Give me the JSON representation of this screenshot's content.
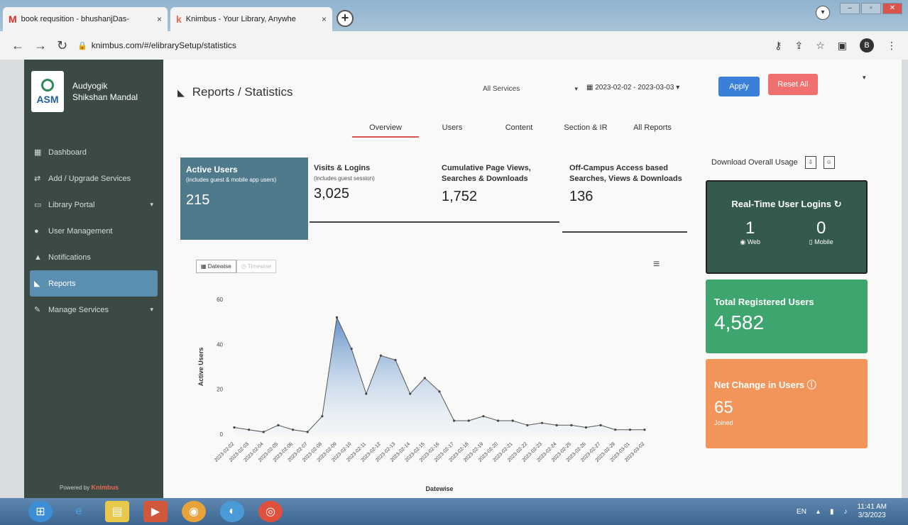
{
  "browser": {
    "tabs": [
      {
        "favicon": "M",
        "title": "book requsition - bhushanjDas-",
        "close": "×"
      },
      {
        "favicon": "k",
        "title": "Knimbus - Your Library, Anywhe",
        "close": "×"
      }
    ],
    "new_tab": "+",
    "url": "knimbus.com/#/elibrarySetup/statistics",
    "profile_initial": "B"
  },
  "sidebar": {
    "brand_logo_text": "ASM",
    "brand_name_line1": "Audyogik",
    "brand_name_line2": "Shikshan Mandal",
    "items": [
      {
        "icon": "▦",
        "label": "Dashboard",
        "arrow": ""
      },
      {
        "icon": "⇄",
        "label": "Add / Upgrade Services",
        "arrow": ""
      },
      {
        "icon": "▭",
        "label": "Library Portal",
        "arrow": "▾"
      },
      {
        "icon": "●",
        "label": "User Management",
        "arrow": ""
      },
      {
        "icon": "▲",
        "label": "Notifications",
        "arrow": ""
      },
      {
        "icon": "◣",
        "label": "Reports",
        "arrow": ""
      },
      {
        "icon": "✎",
        "label": "Manage Services",
        "arrow": "▾"
      }
    ],
    "powered_by": "Powered by",
    "powered_brand": "Knimbus"
  },
  "header": {
    "title": "Reports / Statistics",
    "service_select": "All Services",
    "date_range": "2023-02-02 - 2023-03-03",
    "apply_label": "Apply",
    "reset_label": "Reset All"
  },
  "tabs": [
    "Overview",
    "Users",
    "Content",
    "Section & IR",
    "All Reports"
  ],
  "stats": {
    "active_users": {
      "title": "Active Users",
      "subtitle": "(includes guest & mobile app users)",
      "value": "215"
    },
    "visits": {
      "title": "Visits & Logins",
      "subtitle": "(includes guest session)",
      "value": "3,025"
    },
    "page_views": {
      "title": "Cumulative Page Views, Searches & Downloads",
      "value": "1,752"
    },
    "off_campus": {
      "title": "Off-Campus Access based Searches, Views & Downloads",
      "value": "136"
    }
  },
  "download_label": "Download Overall Usage",
  "cards": {
    "realtime": {
      "title": "Real-Time User Logins",
      "web_value": "1",
      "web_label": "Web",
      "mobile_value": "0",
      "mobile_label": "Mobile"
    },
    "total_registered": {
      "title": "Total Registered Users",
      "value": "4,582"
    },
    "net_change": {
      "title": "Net Change in Users",
      "value": "65",
      "label": "Joined"
    }
  },
  "chart_toggle": {
    "active": "Datewise",
    "inactive": "Timewise"
  },
  "taskbar": {
    "lang": "EN",
    "time": "11:41 AM",
    "date": "3/3/2023"
  },
  "colors": {
    "accent": "#3a7fd8",
    "reset": "#f07070",
    "sidebar": "#3b4a45",
    "line": "#4a6fa5"
  },
  "chart_data": {
    "type": "area",
    "xlabel": "Datewise",
    "ylabel": "Active Users",
    "ylim": [
      0,
      60
    ],
    "yticks": [
      0,
      20,
      40,
      60
    ],
    "x": [
      "2023-02-02",
      "2023-02-03",
      "2023-02-04",
      "2023-02-05",
      "2023-02-06",
      "2023-02-07",
      "2023-02-08",
      "2023-02-09",
      "2023-02-10",
      "2023-02-11",
      "2023-02-12",
      "2023-02-13",
      "2023-02-14",
      "2023-02-15",
      "2023-02-16",
      "2023-02-17",
      "2023-02-18",
      "2023-02-19",
      "2023-02-20",
      "2023-02-21",
      "2023-02-22",
      "2023-02-23",
      "2023-02-24",
      "2023-02-25",
      "2023-02-26",
      "2023-02-27",
      "2023-02-28",
      "2023-03-01",
      "2023-03-02"
    ],
    "values": [
      3,
      2,
      1,
      4,
      2,
      1,
      8,
      52,
      38,
      18,
      35,
      33,
      18,
      25,
      19,
      6,
      6,
      8,
      6,
      6,
      4,
      5,
      4,
      4,
      3,
      4,
      2,
      2,
      2
    ]
  }
}
